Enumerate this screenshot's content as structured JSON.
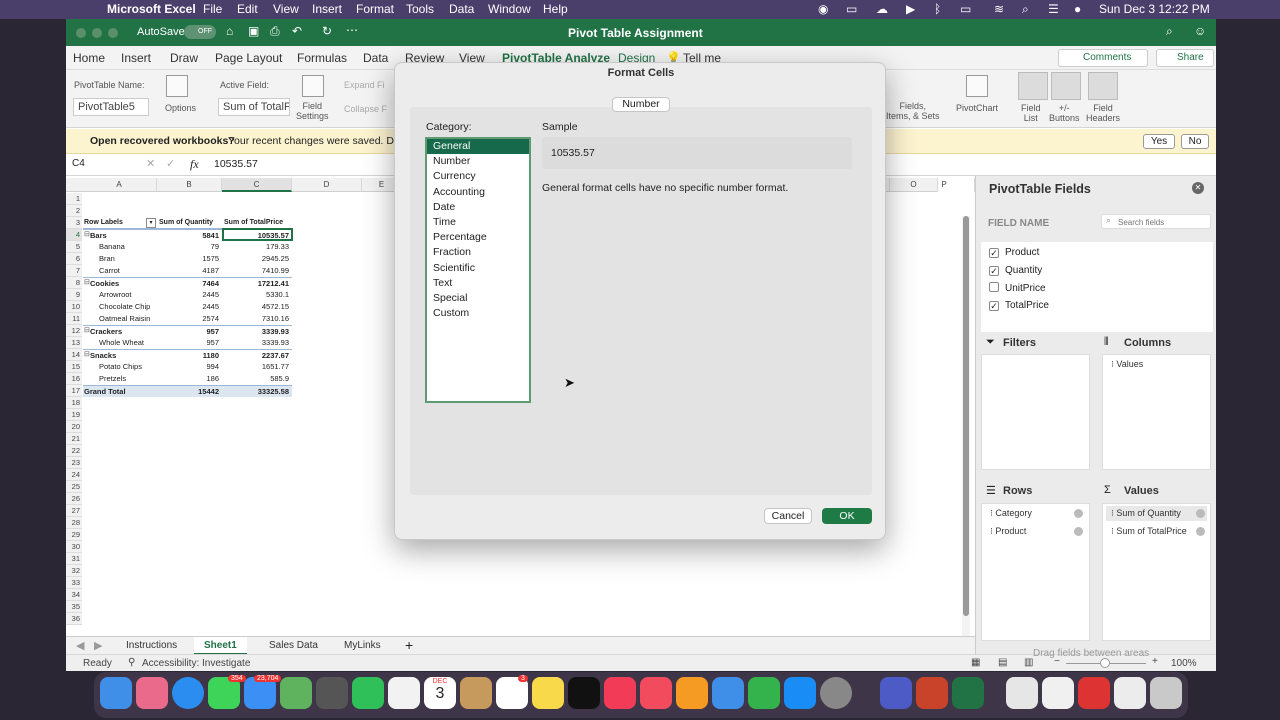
{
  "menubar": {
    "app": "Microsoft Excel",
    "items": [
      "File",
      "Edit",
      "View",
      "Insert",
      "Format",
      "Tools",
      "Data",
      "Window",
      "Help"
    ],
    "clock": "Sun Dec 3  12:22 PM"
  },
  "titlebar": {
    "autosave_label": "AutoSave",
    "autosave_state": "OFF",
    "doc_title": "Pivot Table Assignment"
  },
  "ribbon_tabs": [
    "Home",
    "Insert",
    "Draw",
    "Page Layout",
    "Formulas",
    "Data",
    "Review",
    "View",
    "PivotTable Analyze",
    "Design",
    "Tell me"
  ],
  "ribbon_right": {
    "comments": "Comments",
    "share": "Share"
  },
  "ribbon": {
    "pt_name_label": "PivotTable Name:",
    "pt_name_value": "PivotTable5",
    "options": "Options",
    "active_field_label": "Active Field:",
    "active_field_value": "Sum of TotalP",
    "field_settings": "Field\nSettings",
    "expand": "Expand Fi",
    "collapse": "Collapse F",
    "fields_items": "Fields,\nItems, & Sets",
    "pivotchart": "PivotChart",
    "field_list": "Field\nList",
    "buttons": "+/-\nButtons",
    "field_headers": "Field\nHeaders"
  },
  "msgbar": {
    "bold": "Open recovered workbooks?",
    "text": "Your recent changes were saved. Do",
    "yes": "Yes",
    "no": "No"
  },
  "formulabar": {
    "namebox": "C4",
    "fx": "fx",
    "value": "10535.57"
  },
  "columns": [
    "A",
    "B",
    "C",
    "D",
    "E",
    "O",
    "P"
  ],
  "rows": [
    "1",
    "2",
    "3",
    "4",
    "5",
    "6",
    "7",
    "8",
    "9",
    "10",
    "11",
    "12",
    "13",
    "14",
    "15",
    "16",
    "17",
    "18",
    "19",
    "20",
    "21",
    "22",
    "23",
    "24",
    "25",
    "26",
    "27",
    "28",
    "29",
    "30",
    "31",
    "32",
    "33",
    "34",
    "35",
    "36"
  ],
  "pivot": {
    "headers": [
      "Row Labels",
      "Sum of Quantity",
      "Sum of TotalPrice"
    ],
    "rows": [
      {
        "label": "Bars",
        "qty": "5841",
        "total": "10535.57",
        "level": 0
      },
      {
        "label": "Banana",
        "qty": "79",
        "total": "179.33",
        "level": 1
      },
      {
        "label": "Bran",
        "qty": "1575",
        "total": "2945.25",
        "level": 1
      },
      {
        "label": "Carrot",
        "qty": "4187",
        "total": "7410.99",
        "level": 1
      },
      {
        "label": "Cookies",
        "qty": "7464",
        "total": "17212.41",
        "level": 0
      },
      {
        "label": "Arrowroot",
        "qty": "2445",
        "total": "5330.1",
        "level": 1
      },
      {
        "label": "Chocolate Chip",
        "qty": "2445",
        "total": "4572.15",
        "level": 1
      },
      {
        "label": "Oatmeal Raisin",
        "qty": "2574",
        "total": "7310.16",
        "level": 1
      },
      {
        "label": "Crackers",
        "qty": "957",
        "total": "3339.93",
        "level": 0
      },
      {
        "label": "Whole Wheat",
        "qty": "957",
        "total": "3339.93",
        "level": 1
      },
      {
        "label": "Snacks",
        "qty": "1180",
        "total": "2237.67",
        "level": 0
      },
      {
        "label": "Potato Chips",
        "qty": "994",
        "total": "1651.77",
        "level": 1
      },
      {
        "label": "Pretzels",
        "qty": "186",
        "total": "585.9",
        "level": 1
      },
      {
        "label": "Grand Total",
        "qty": "15442",
        "total": "33325.58",
        "level": 2
      }
    ]
  },
  "sheet_tabs": [
    "Instructions",
    "Sheet1",
    "Sales Data",
    "MyLinks"
  ],
  "active_sheet": "Sheet1",
  "status": {
    "ready": "Ready",
    "accessibility": "Accessibility: Investigate",
    "zoom": "100%"
  },
  "pivot_fields": {
    "title": "PivotTable Fields",
    "field_name": "FIELD NAME",
    "search_placeholder": "Search fields",
    "fields": [
      {
        "name": "Product",
        "checked": true
      },
      {
        "name": "Quantity",
        "checked": true
      },
      {
        "name": "UnitPrice",
        "checked": false
      },
      {
        "name": "TotalPrice",
        "checked": true
      }
    ],
    "filters_label": "Filters",
    "columns_label": "Columns",
    "columns_items": [
      "Values"
    ],
    "rows_label": "Rows",
    "rows_items": [
      "Category",
      "Product"
    ],
    "values_label": "Values",
    "values_items": [
      "Sum of Quantity",
      "Sum of TotalPrice"
    ],
    "drag_hint": "Drag fields between areas"
  },
  "dialog": {
    "title": "Format Cells",
    "tab": "Number",
    "category_label": "Category:",
    "categories": [
      "General",
      "Number",
      "Currency",
      "Accounting",
      "Date",
      "Time",
      "Percentage",
      "Fraction",
      "Scientific",
      "Text",
      "Special",
      "Custom"
    ],
    "selected_category": "General",
    "sample_label": "Sample",
    "sample_value": "10535.57",
    "description": "General format cells have no specific number format.",
    "cancel": "Cancel",
    "ok": "OK"
  },
  "dock_badges": {
    "messages": "354",
    "mail": "23,704",
    "reminders": "3",
    "calendar_month": "DEC",
    "calendar_day": "3"
  },
  "colors": {
    "excel_green": "#217346",
    "menubar": "#4a3f6b",
    "selected_category": "#16694a",
    "ok_button": "#1e7b46"
  }
}
